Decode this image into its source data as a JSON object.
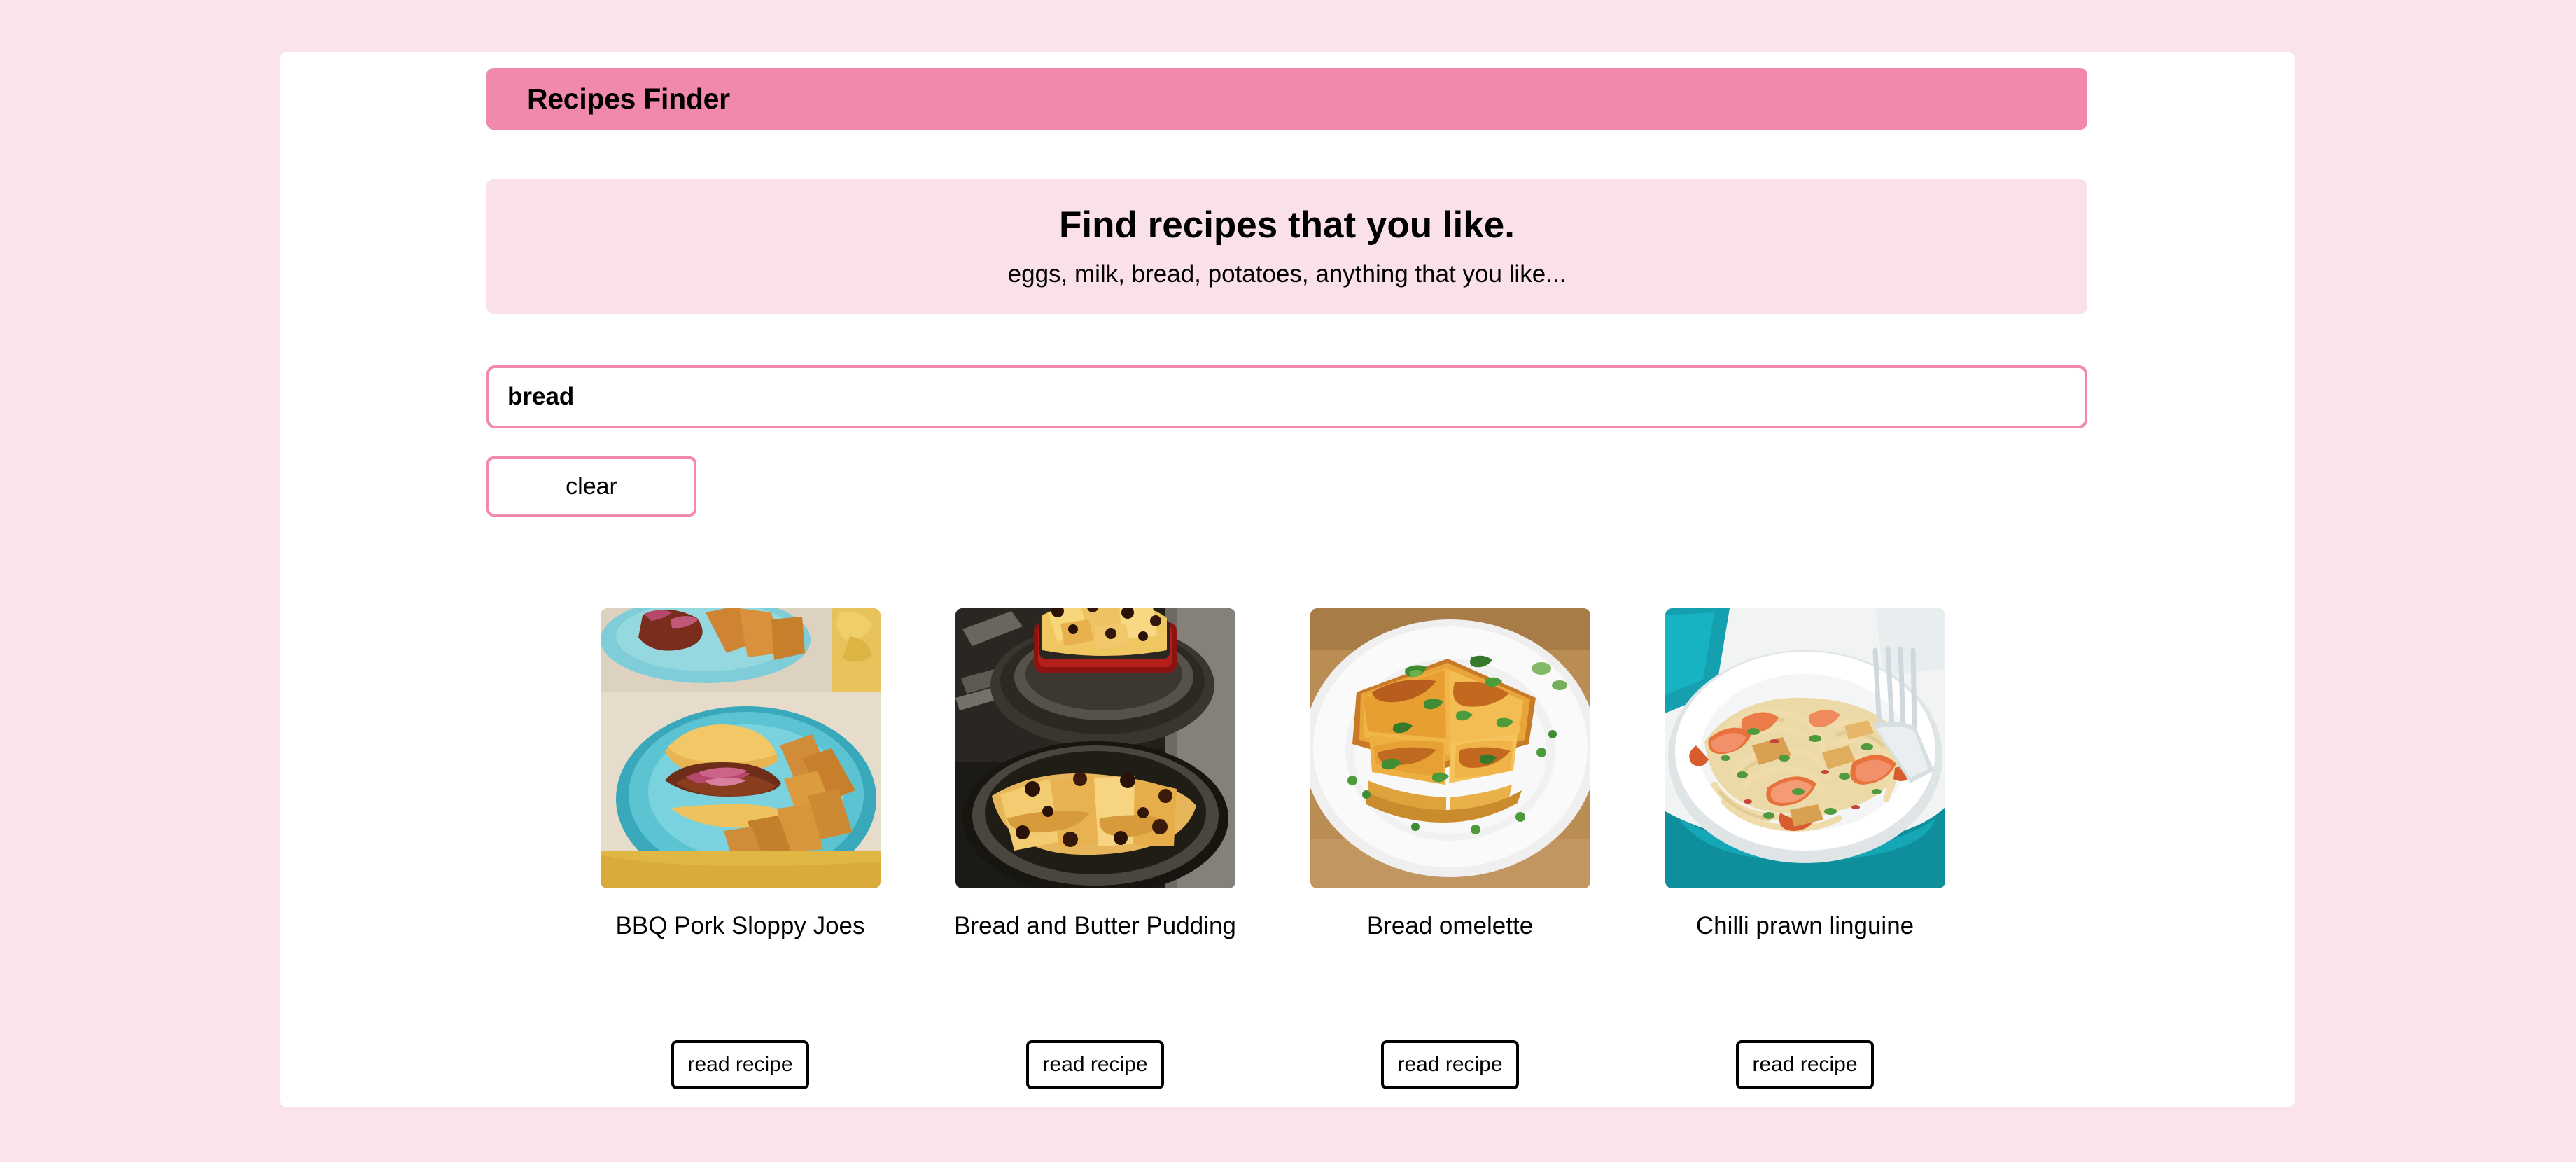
{
  "page": {
    "background_color": "#fae3ea",
    "container_color": "#ffffff"
  },
  "header": {
    "title": "Recipes Finder",
    "background_color": "#f089ab"
  },
  "hero": {
    "heading": "Find recipes that you like.",
    "subheading": "eggs, milk, bread, potatoes, anything that you like...",
    "background_color": "#fae0e9"
  },
  "search": {
    "value": "bread",
    "placeholder": "",
    "border_color": "#f089ab",
    "clear_label": "clear"
  },
  "results": {
    "read_recipe_label": "read recipe",
    "cards": [
      {
        "title": "BBQ Pork Sloppy Joes",
        "image_alt": "bbq-pork-sloppy-joes-photo",
        "read_recipe_label": "read recipe"
      },
      {
        "title": "Bread and Butter Pudding",
        "image_alt": "bread-and-butter-pudding-photo",
        "read_recipe_label": "read recipe"
      },
      {
        "title": "Bread omelette",
        "image_alt": "bread-omelette-photo",
        "read_recipe_label": "read recipe"
      },
      {
        "title": "Chilli prawn linguine",
        "image_alt": "chilli-prawn-linguine-photo",
        "read_recipe_label": "read recipe"
      }
    ]
  }
}
